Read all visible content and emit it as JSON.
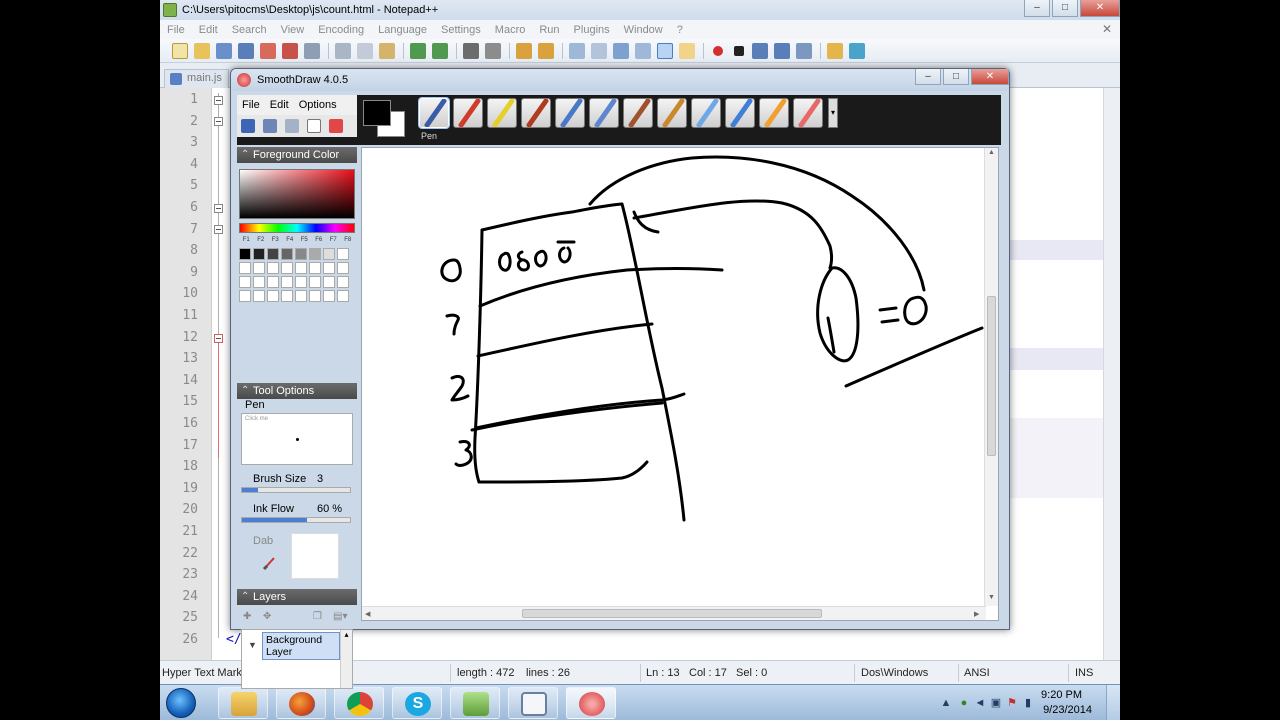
{
  "npp": {
    "title": "C:\\Users\\pitocms\\Desktop\\js\\count.html - Notepad++",
    "menu": [
      "File",
      "Edit",
      "Search",
      "View",
      "Encoding",
      "Language",
      "Settings",
      "Macro",
      "Run",
      "Plugins",
      "Window",
      "?"
    ],
    "tabs": [
      "main.js"
    ],
    "line_numbers": [
      "1",
      "2",
      "3",
      "4",
      "5",
      "6",
      "7",
      "8",
      "9",
      "10",
      "11",
      "12",
      "13",
      "14",
      "15",
      "16",
      "17",
      "18",
      "19",
      "20",
      "21",
      "22",
      "23",
      "24",
      "25",
      "26"
    ],
    "code_last_line": "</html>",
    "status": {
      "file_type": "Hyper Text Markup Language file",
      "length": "length : 472",
      "lines": "lines : 26",
      "ln": "Ln : 13",
      "col": "Col : 17",
      "sel": "Sel : 0",
      "eol": "Dos\\Windows",
      "encoding": "ANSI",
      "mode": "INS"
    }
  },
  "smoothdraw": {
    "title": "SmoothDraw 4.0.5",
    "menu": [
      "File",
      "Edit",
      "Options"
    ],
    "brush_label": "Pen",
    "foreground_color_title": "Foreground Color",
    "fkeys": [
      "F1",
      "F2",
      "F3",
      "F4",
      "F5",
      "F6",
      "F7",
      "F8"
    ],
    "tool_options_title": "Tool Options",
    "tool_name": "Pen",
    "preview_hint": "Click me",
    "brush_size_label": "Brush Size",
    "brush_size_value": "3",
    "brush_size_fraction": 0.15,
    "ink_flow_label": "Ink Flow",
    "ink_flow_value": "60 %",
    "ink_flow_fraction": 0.6,
    "dab_label": "Dab",
    "layers_title": "Layers",
    "layer_name": "Background Layer",
    "foreground_color": "#000000",
    "background_color": "#ffffff",
    "canvas_text": [
      "0 8 0 0",
      "0",
      "1",
      "2",
      "3",
      "=0"
    ]
  },
  "taskbar": {
    "apps": [
      "windows-explorer",
      "firefox",
      "chrome",
      "skype",
      "notepad-plus-plus",
      "window-app",
      "smoothdraw"
    ],
    "time": "9:20 PM",
    "date": "9/23/2014"
  }
}
